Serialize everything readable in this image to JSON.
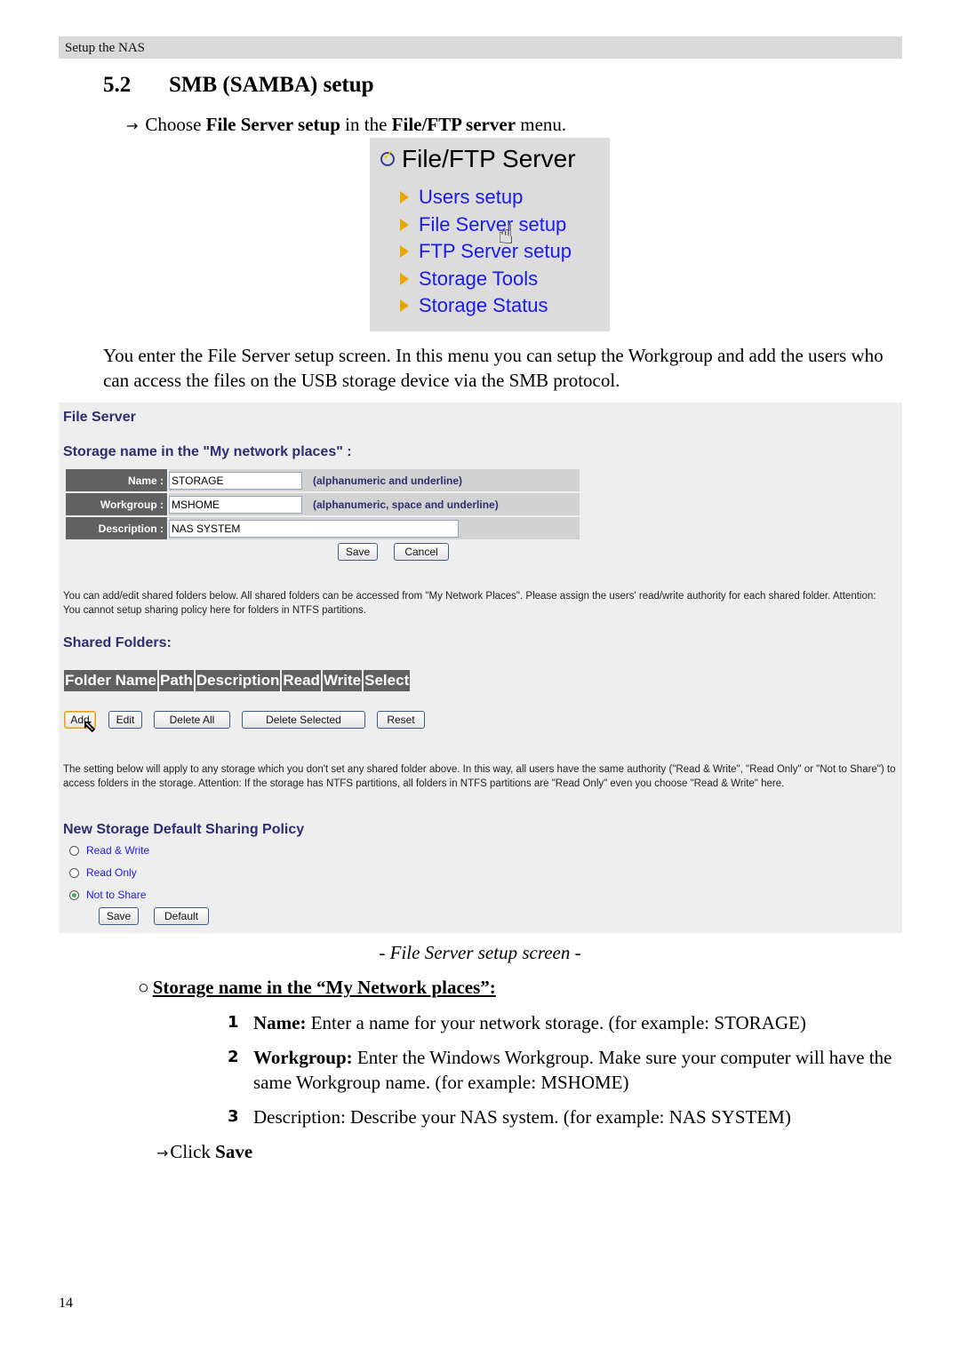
{
  "header": {
    "running_title": "Setup the NAS"
  },
  "section": {
    "number": "5.2",
    "title": "SMB (SAMBA) setup"
  },
  "instruction": {
    "arrow_icon": "right-arrow",
    "prefix": "Choose ",
    "bold1": "File Server setup",
    "middle": " in the ",
    "bold2": "File/FTP server",
    "suffix": " menu."
  },
  "menu_screenshot": {
    "title": "File/FTP Server",
    "title_icon": "check-circle",
    "items": [
      {
        "label": "Users setup"
      },
      {
        "label": "File Server setup"
      },
      {
        "label": "FTP Server setup"
      },
      {
        "label": "Storage Tools"
      },
      {
        "label": "Storage Status"
      }
    ],
    "cursor": "hand-pointer"
  },
  "intro_paragraph": "You enter the File Server setup screen. In this menu you can setup the Workgroup and add the users who can access the files on the USB storage device via the SMB protocol.",
  "file_server": {
    "title": "File Server",
    "storage_heading": "Storage name in the \"My network places\"  :",
    "fields": [
      {
        "label": "Name :",
        "value": "STORAGE",
        "hint": "(alphanumeric and underline)"
      },
      {
        "label": "Workgroup :",
        "value": "MSHOME",
        "hint": "(alphanumeric, space and underline)"
      },
      {
        "label": "Description :",
        "value": "NAS SYSTEM",
        "hint": ""
      }
    ],
    "save_label": "Save",
    "cancel_label": "Cancel",
    "shared_info": "You can add/edit shared folders below. All shared folders can be accessed from \"My Network Places\". Please assign the users' read/write authority for each shared folder. Attention: You cannot setup sharing policy here for folders in NTFS partitions.",
    "shared_heading": "Shared Folders:",
    "shared_columns": [
      "Folder Name",
      "Path",
      "Description",
      "Read",
      "Write",
      "Select"
    ],
    "shared_buttons": {
      "add": "Add",
      "edit": "Edit",
      "delete_all": "Delete All",
      "delete_selected": "Delete Selected",
      "reset": "Reset"
    },
    "policy_info": "The setting below will apply to any storage which you don't set any shared folder above. In this way, all users have the same authority (\"Read & Write\", \"Read Only\" or \"Not to Share\") to access folders in the storage. Attention: If the storage has NTFS partitions, all folders in NTFS partitions are \"Read Only\" even you choose \"Read & Write\" here.",
    "policy_heading": "New Storage Default Sharing Policy",
    "policy_options": [
      {
        "label": "Read & Write",
        "checked": false
      },
      {
        "label": "Read Only",
        "checked": false
      },
      {
        "label": "Not to Share",
        "checked": true
      }
    ],
    "policy_save": "Save",
    "policy_default": "Default"
  },
  "caption": "- File Server setup screen -",
  "subheading": {
    "bullet": "○",
    "text": "Storage name in the “My Network places”:"
  },
  "steps": [
    {
      "n": "1",
      "bold": "Name:",
      "text": " Enter a name for your network storage. (for example: STORAGE)"
    },
    {
      "n": "2",
      "bold": "Workgroup:",
      "text": " Enter the Windows Workgroup. Make sure your computer will have the same Workgroup name. (for example: MSHOME)"
    },
    {
      "n": "3",
      "bold": "",
      "text": "Description: Describe your NAS system. (for example: NAS SYSTEM)"
    }
  ],
  "click_save": {
    "prefix": "Click ",
    "bold": "Save"
  },
  "page_number": "14"
}
